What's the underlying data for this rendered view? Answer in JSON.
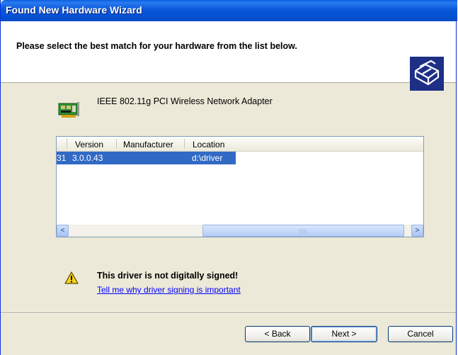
{
  "window": {
    "title": "Found New Hardware Wizard"
  },
  "header": {
    "prompt": "Please select the best match for your hardware from the list below.",
    "icon": "hardware-wizard-icon"
  },
  "device": {
    "name": "IEEE 802.11g PCI Wireless Network Adapter",
    "icon": "network-card-icon"
  },
  "driver_list": {
    "columns": [
      "Version",
      "Manufacturer",
      "Location"
    ],
    "rows": [
      {
        "prefix": "31",
        "version": "3.0.0.43",
        "manufacturer": "",
        "location": "d:\\driver"
      }
    ],
    "scroll_left": "<",
    "scroll_right": ">"
  },
  "warning": {
    "icon": "warning-icon",
    "text": "This driver is not digitally signed!",
    "link": "Tell me why driver signing is important"
  },
  "buttons": {
    "back": "< Back",
    "next": "Next >",
    "cancel": "Cancel"
  }
}
